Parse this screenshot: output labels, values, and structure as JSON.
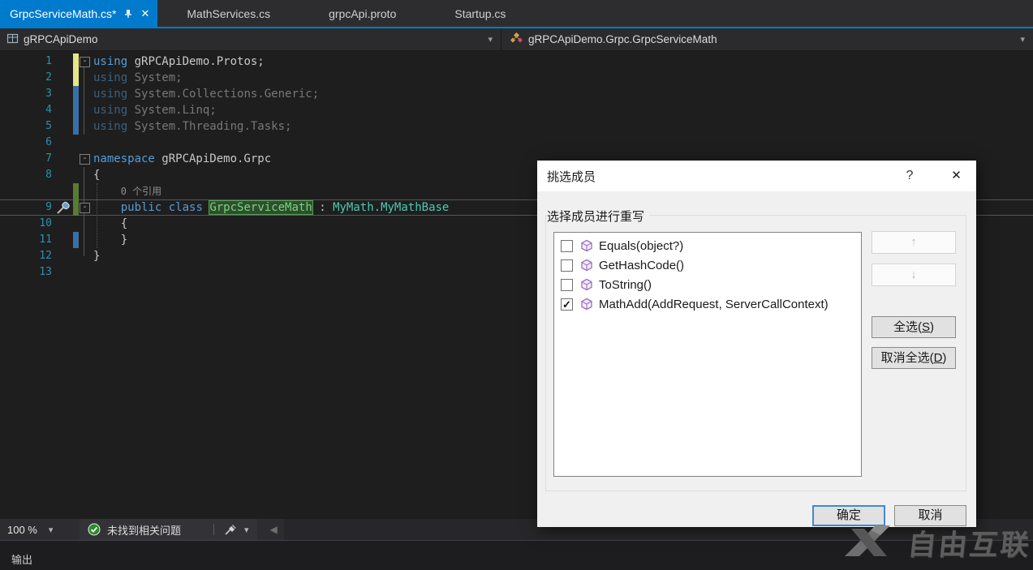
{
  "tabs": {
    "items": [
      {
        "label": "GrpcServiceMath.cs*",
        "active": true
      },
      {
        "label": "MathServices.cs",
        "active": false
      },
      {
        "label": "grpcApi.proto",
        "active": false
      },
      {
        "label": "Startup.cs",
        "active": false
      }
    ]
  },
  "navbar": {
    "project": "gRPCApiDemo",
    "type_path": "gRPCApiDemo.Grpc.GrpcServiceMath"
  },
  "editor": {
    "lines": [
      {
        "num": "1",
        "fold": true,
        "bar": "yellow",
        "indent": 0,
        "tokens": [
          {
            "t": "using",
            "c": "kw"
          },
          {
            "t": " gRPCApiDemo.Protos;",
            "c": "pl"
          }
        ]
      },
      {
        "num": "2",
        "bar": "yellow",
        "dim": true,
        "indent": 0,
        "tokens": [
          {
            "t": "using",
            "c": "kw"
          },
          {
            "t": " System;",
            "c": "pl"
          }
        ]
      },
      {
        "num": "3",
        "bar": "blue",
        "dim": true,
        "indent": 0,
        "tokens": [
          {
            "t": "using",
            "c": "kw"
          },
          {
            "t": " System.Collections.Generic;",
            "c": "pl"
          }
        ]
      },
      {
        "num": "4",
        "bar": "blue",
        "dim": true,
        "indent": 0,
        "tokens": [
          {
            "t": "using",
            "c": "kw"
          },
          {
            "t": " System.Linq;",
            "c": "pl"
          }
        ]
      },
      {
        "num": "5",
        "bar": "blue",
        "dim": true,
        "indent": 0,
        "tokens": [
          {
            "t": "using",
            "c": "kw"
          },
          {
            "t": " System.Threading.Tasks;",
            "c": "pl"
          }
        ]
      },
      {
        "num": "6",
        "indent": 0,
        "tokens": []
      },
      {
        "num": "7",
        "fold": true,
        "indent": 0,
        "tokens": [
          {
            "t": "namespace",
            "c": "kw"
          },
          {
            "t": " gRPCApiDemo.Grpc",
            "c": "pl"
          }
        ]
      },
      {
        "num": "8",
        "indent": 0,
        "tokens": [
          {
            "t": "{",
            "c": "pl"
          }
        ]
      },
      {
        "num": "",
        "bar": "green",
        "indent": 1,
        "tokens": [
          {
            "t": "0 个引用",
            "c": "lens"
          }
        ]
      },
      {
        "num": "9",
        "fold": true,
        "bar": "green",
        "glyph": "screwdriver",
        "current": true,
        "indent": 1,
        "tokens": [
          {
            "t": "public",
            "c": "kw"
          },
          {
            "t": " ",
            "c": "pl"
          },
          {
            "t": "class",
            "c": "kw"
          },
          {
            "t": " ",
            "c": "pl"
          },
          {
            "t": "GrpcServiceMath",
            "c": "hl"
          },
          {
            "t": " : ",
            "c": "pl"
          },
          {
            "t": "MyMath.MyMathBase",
            "c": "ty"
          }
        ]
      },
      {
        "num": "10",
        "indent": 1,
        "tokens": [
          {
            "t": "{",
            "c": "pl"
          }
        ]
      },
      {
        "num": "11",
        "bar": "blue",
        "indent": 1,
        "tokens": [
          {
            "t": "}",
            "c": "pl"
          }
        ]
      },
      {
        "num": "12",
        "indent": 0,
        "tokens": [
          {
            "t": "}",
            "c": "pl"
          }
        ]
      },
      {
        "num": "13",
        "indent": 0,
        "tokens": []
      }
    ],
    "statusbar": {
      "zoom": "100 %",
      "health": "未找到相关问题"
    }
  },
  "output": {
    "title": "输出"
  },
  "dialog": {
    "title": "挑选成员",
    "group_label": "选择成员进行重写",
    "members": [
      {
        "label": "Equals(object?)",
        "checked": false
      },
      {
        "label": "GetHashCode()",
        "checked": false
      },
      {
        "label": "ToString()",
        "checked": false
      },
      {
        "label": "MathAdd(AddRequest, ServerCallContext)",
        "checked": true
      }
    ],
    "buttons": {
      "select_all_pre": "全选(",
      "select_all_key": "S",
      "select_all_post": ")",
      "deselect_all_pre": "取消全选(",
      "deselect_all_key": "D",
      "deselect_all_post": ")",
      "ok": "确定",
      "cancel": "取消"
    }
  },
  "watermark": {
    "text": "自由互联"
  },
  "icons": {
    "caret": "▾",
    "scroll_left": "◀",
    "up_arrow": "↑",
    "down_arrow": "↓",
    "close": "✕",
    "help": "?",
    "check": "✓",
    "fold_collapse": "-"
  },
  "colors": {
    "accent": "#007acc",
    "keyword": "#569cd6",
    "type_name": "#4ec9b0",
    "line_number": "#2b91af",
    "change_unsaved": "#e6e687",
    "change_saved": "#587a36",
    "change_blue": "#3a6fa5",
    "highlight_bg": "#2d4f2d",
    "highlight_border": "#5a9e5a",
    "health_ok": "#2d8a2d",
    "method_icon": "#9a6fc4"
  }
}
